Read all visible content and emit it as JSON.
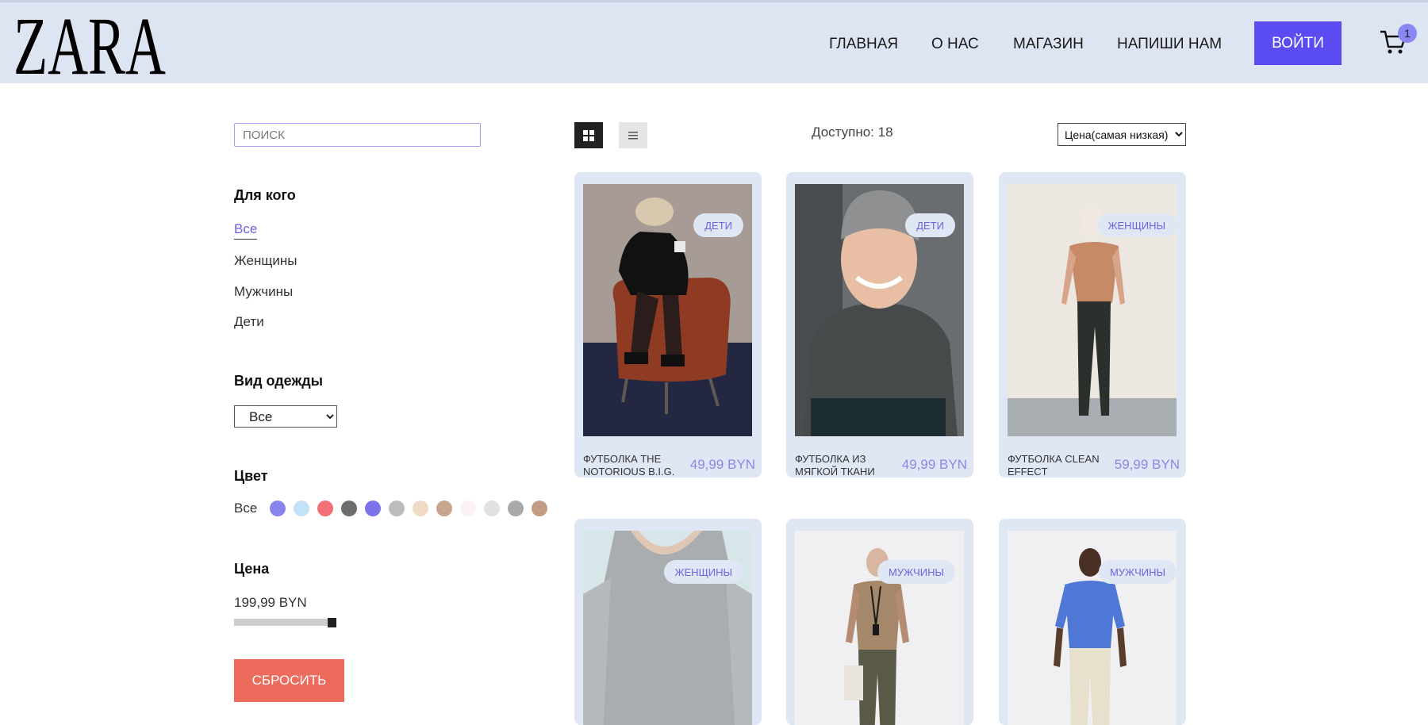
{
  "header": {
    "logo": "ZARA",
    "nav": [
      "ГЛАВНАЯ",
      "О НАС",
      "МАГАЗИН",
      "НАПИШИ НАМ"
    ],
    "login_label": "ВОЙТИ",
    "cart_count": "1"
  },
  "sidebar": {
    "search_placeholder": "ПОИСК",
    "audience_title": "Для кого",
    "audience": [
      "Все",
      "Женщины",
      "Мужчины",
      "Дети"
    ],
    "type_title": "Вид одежды",
    "type_selected": "Все",
    "color_title": "Цвет",
    "color_all": "Все",
    "colors": [
      "#8784ee",
      "#c4e3f8",
      "#f27077",
      "#6e6e6e",
      "#7c72ea",
      "#bcbcbc",
      "#f0dcc4",
      "#c9a48e",
      "#fcf1f3",
      "#e1e1e1",
      "#a9a9a9",
      "#c29d84"
    ],
    "price_title": "Цена",
    "price_value": "199,99 BYN",
    "reset_label": "СБРОСИТЬ"
  },
  "toolbar": {
    "available": "Доступно: 18",
    "sort_selected": "Цена(самая низкая)"
  },
  "products": [
    {
      "tag": "ДЕТИ",
      "name": "ФУТБОЛКА THE NOTORIOUS B.I.G.",
      "price": "49,99 BYN",
      "image": "child-on-leather-armchair"
    },
    {
      "tag": "ДЕТИ",
      "name": "ФУТБОЛКА ИЗ МЯГКОЙ ТКАНИ",
      "price": "49,99 BYN",
      "image": "smiling-boy-grey-sweater"
    },
    {
      "tag": "ЖЕНЩИНЫ",
      "name": "ФУТБОЛКА CLEAN EFFECT",
      "price": "59,99 BYN",
      "image": "woman-orange-tshirt"
    },
    {
      "tag": "ЖЕНЩИНЫ",
      "name": "",
      "price": "",
      "image": "woman-grey-longsleeve"
    },
    {
      "tag": "МУЖЧИНЫ",
      "name": "",
      "price": "",
      "image": "man-beige-tshirt"
    },
    {
      "tag": "МУЖЧИНЫ",
      "name": "",
      "price": "",
      "image": "man-blue-tshirt"
    }
  ]
}
